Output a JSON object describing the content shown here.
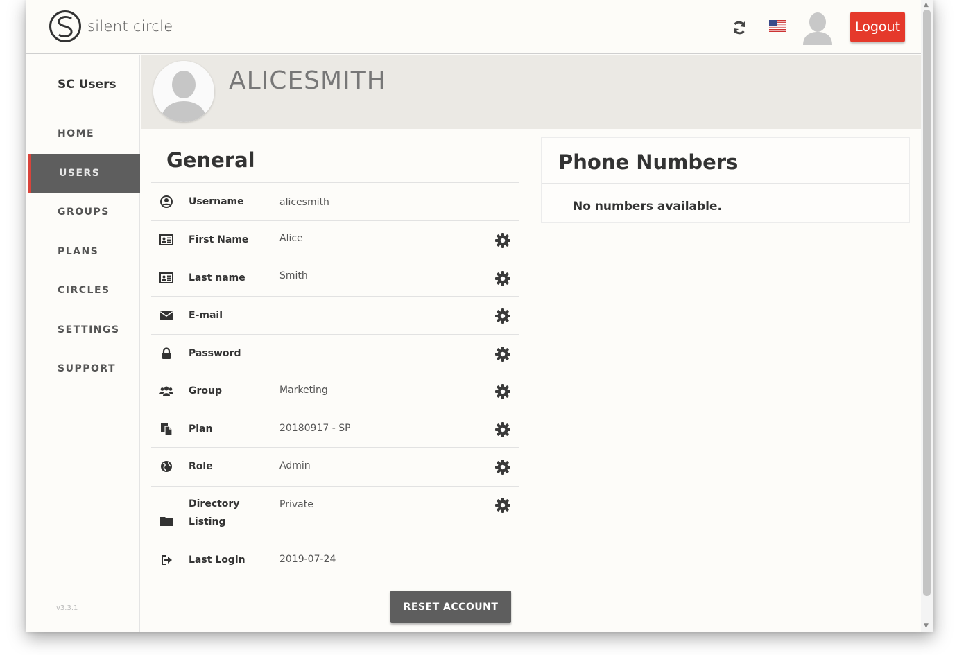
{
  "header": {
    "logo_text": "silent circle",
    "logout_label": "Logout"
  },
  "sidebar": {
    "app_name": "SC Users",
    "items": [
      {
        "label": "HOME",
        "active": false
      },
      {
        "label": "USERS",
        "active": true
      },
      {
        "label": "GROUPS",
        "active": false
      },
      {
        "label": "PLANS",
        "active": false
      },
      {
        "label": "CIRCLES",
        "active": false
      },
      {
        "label": "SETTINGS",
        "active": false
      },
      {
        "label": "SUPPORT",
        "active": false
      }
    ],
    "version": "v3.3.1"
  },
  "profile": {
    "name": "ALICESMITH"
  },
  "general": {
    "title": "General",
    "rows": [
      {
        "label": "Username",
        "value": "alicesmith",
        "icon": "user-circle-icon",
        "editable": false
      },
      {
        "label": "First Name",
        "value": "Alice",
        "icon": "id-card-icon",
        "editable": true
      },
      {
        "label": "Last name",
        "value": "Smith",
        "icon": "id-card-icon",
        "editable": true
      },
      {
        "label": "E-mail",
        "value": "",
        "icon": "envelope-icon",
        "editable": true
      },
      {
        "label": "Password",
        "value": "",
        "icon": "lock-icon",
        "editable": true
      },
      {
        "label": "Group",
        "value": "Marketing",
        "icon": "users-icon",
        "editable": true
      },
      {
        "label": "Plan",
        "value": "20180917 - SP",
        "icon": "copy-icon",
        "editable": true
      },
      {
        "label": "Role",
        "value": "Admin",
        "icon": "globe-icon",
        "editable": true
      },
      {
        "label": "Directory Listing",
        "value": "Private",
        "icon": "folder-icon",
        "editable": true
      },
      {
        "label": "Last Login",
        "value": "2019-07-24",
        "icon": "sign-in-icon",
        "editable": false
      }
    ],
    "reset_label": "RESET ACCOUNT"
  },
  "phone_numbers": {
    "title": "Phone Numbers",
    "empty_text": "No numbers available."
  },
  "colors": {
    "accent": "#e5392b",
    "nav_active_bg": "#5e5e5e",
    "banner_bg": "#ebe9e4"
  }
}
